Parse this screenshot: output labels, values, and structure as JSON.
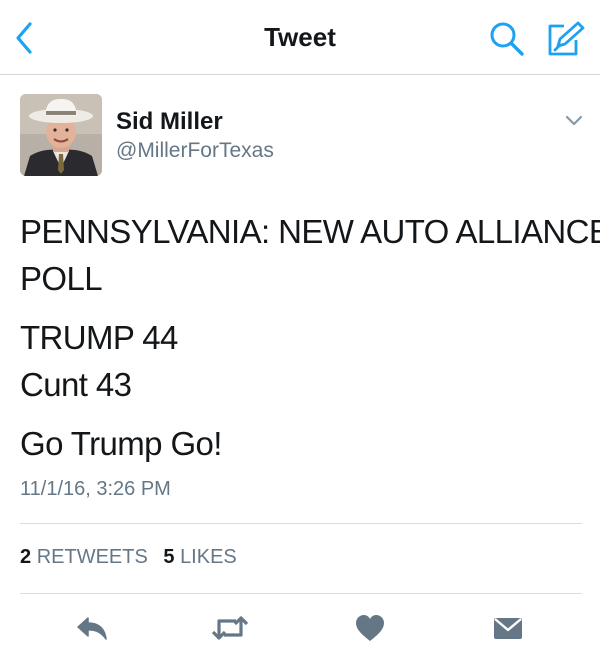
{
  "header": {
    "title": "Tweet",
    "back_icon": "chevron-left-icon",
    "search_icon": "search-icon",
    "compose_icon": "compose-icon",
    "accent_color": "#1da1f2"
  },
  "tweet": {
    "author": {
      "name": "Sid Miller",
      "handle": "@MillerForTexas",
      "avatar_icon": "avatar"
    },
    "text_lines": [
      "PENNSYLVANIA: NEW AUTO ALLIANCE",
      "POLL",
      "TRUMP 44",
      "Cunt 43",
      "Go Trump Go!"
    ],
    "timestamp": "11/1/16, 3:26 PM",
    "stats": {
      "retweets_count": "2",
      "retweets_label": "RETWEETS",
      "likes_count": "5",
      "likes_label": "LIKES"
    }
  },
  "actions": [
    {
      "name": "reply-icon"
    },
    {
      "name": "retweet-icon"
    },
    {
      "name": "like-icon"
    },
    {
      "name": "direct-message-icon"
    }
  ],
  "colors": {
    "text": "#14171a",
    "secondary_text": "#657786",
    "action_icon": "#657786",
    "divider": "#d8dde1"
  }
}
